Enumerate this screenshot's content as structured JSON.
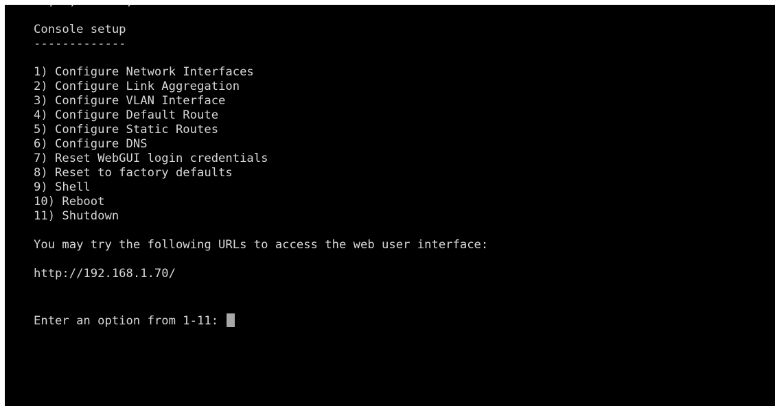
{
  "colors": {
    "background": "#000000",
    "foreground": "#d8d8d8",
    "cursor": "#a8a8a8"
  },
  "console": {
    "title": "Console setup",
    "underline": "-------------",
    "menu": [
      "1) Configure Network Interfaces",
      "2) Configure Link Aggregation",
      "3) Configure VLAN Interface",
      "4) Configure Default Route",
      "5) Configure Static Routes",
      "6) Configure DNS",
      "7) Reset WebGUI login credentials",
      "8) Reset to factory defaults",
      "9) Shell",
      "10) Reboot",
      "11) Shutdown"
    ],
    "url_intro": "You may try the following URLs to access the web user interface:",
    "url": "http://192.168.1.70/",
    "prompt": "Enter an option from 1-11: "
  }
}
